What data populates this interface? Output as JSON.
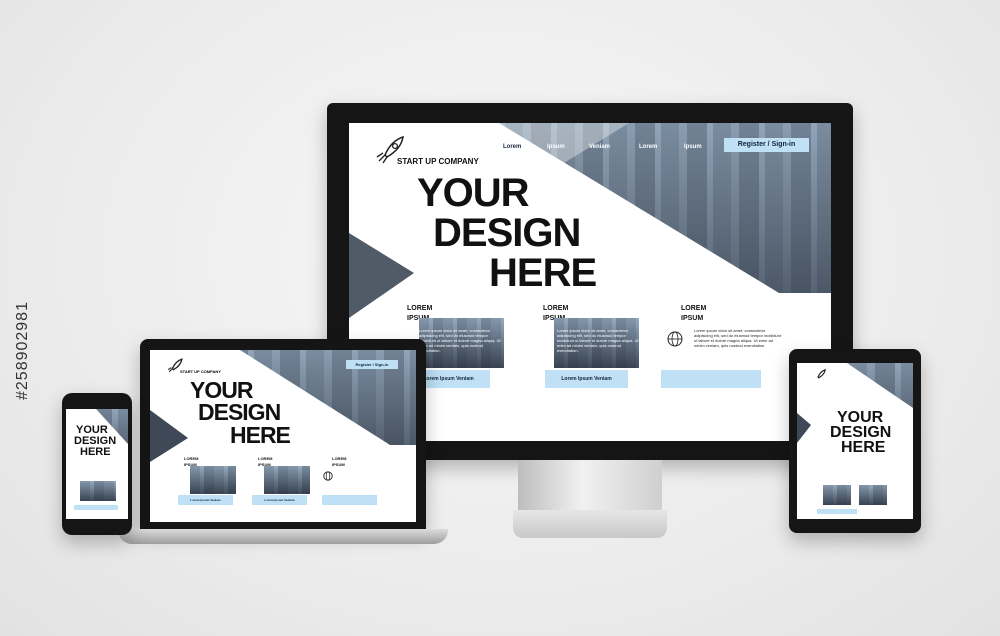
{
  "brand": {
    "name": "START UP COMPANY",
    "icon": "rocket-icon"
  },
  "hero": {
    "line1": "YOUR",
    "line2": "DESIGN",
    "line3": "HERE"
  },
  "nav": {
    "items": [
      "Lorem",
      "Ipsum",
      "Veniam",
      "Lorem",
      "Ipsum"
    ],
    "register": "Register / Sign-in"
  },
  "columns": [
    {
      "title1": "LOREM",
      "title2": "IPSUM",
      "text": "Lorem ipsum dolor sit amet, consectetur adipisicing elit, sed do eiusmod tempor incididunt ut labore et dolore magna aliqua. Ut enim ad minim veniam, quis nostrud exercitation.",
      "button": "Lorem Ipsum Veniam"
    },
    {
      "title1": "LOREM",
      "title2": "IPSUM",
      "text": "Lorem ipsum dolor sit amet, consectetur adipisicing elit, sed do eiusmod tempor incididunt ut labore et dolore magna aliqua. Ut enim ad minim veniam, quis nostrud exercitation.",
      "button": "Lorem Ipsum Veniam"
    },
    {
      "title1": "LOREM",
      "title2": "IPSUM",
      "text": "Lorem ipsum dolor sit amet, consectetur adipisicing elit, sed do eiusmod tempor incididunt ut labore et dolore magna aliqua. Ut enim ad minim veniam, quis nostrud exercitation.",
      "button": ""
    }
  ],
  "stock_id": "#258902981",
  "colors": {
    "accent": "#bfe0f5",
    "frame": "#151515",
    "background": "#ececec"
  }
}
